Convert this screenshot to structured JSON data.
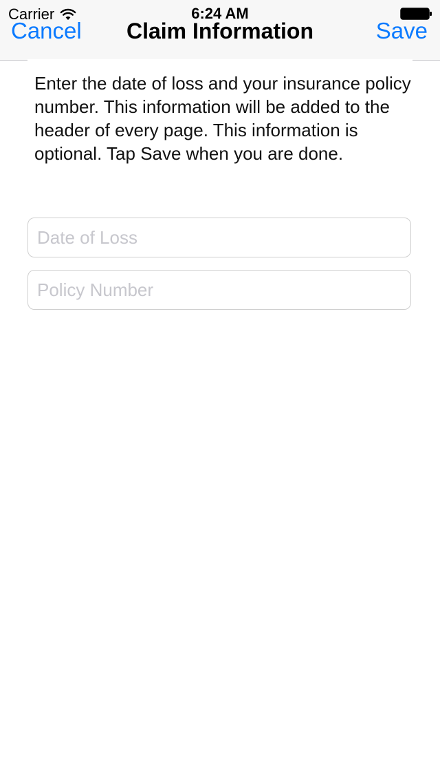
{
  "status_bar": {
    "carrier": "Carrier",
    "time": "6:24 AM",
    "wifi_icon": "wifi-icon",
    "battery_icon": "battery-icon"
  },
  "nav_bar": {
    "cancel_label": "Cancel",
    "title": "Claim Information",
    "save_label": "Save",
    "accent_color": "#0A7AFF"
  },
  "content": {
    "intro": "Enter the date of loss and your insurance policy number. This information will be added to the header of every page. This information is optional. Tap Save when you are done.",
    "date_of_loss": {
      "value": "",
      "placeholder": "Date of Loss"
    },
    "policy_number": {
      "value": "",
      "placeholder": "Policy Number"
    }
  }
}
